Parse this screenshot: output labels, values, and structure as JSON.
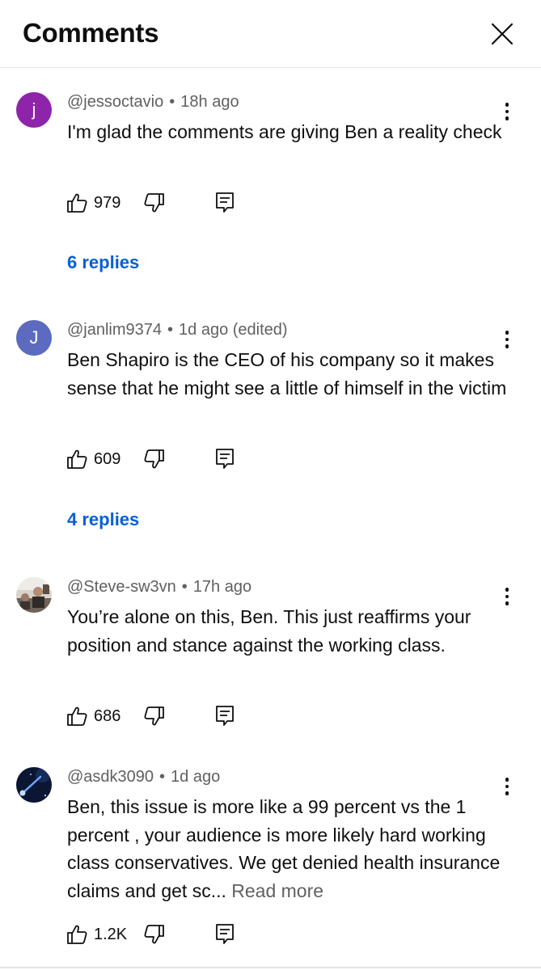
{
  "header": {
    "title": "Comments"
  },
  "comments": [
    {
      "avatar_letter": "j",
      "avatar_color": "#8e24aa",
      "handle": "@jessoctavio",
      "separator": "•",
      "time": "18h ago",
      "text": "I'm glad the comments are giving Ben a reality check",
      "likes": "979",
      "replies_label": "6 replies"
    },
    {
      "avatar_letter": "J",
      "avatar_color": "#5c6bc0",
      "handle": "@janlim9374",
      "separator": "•",
      "time": "1d ago (edited)",
      "text": "Ben Shapiro is the CEO of his company so it makes sense that he might see a little of himself in the victim",
      "likes": "609",
      "replies_label": "4 replies"
    },
    {
      "avatar_letter": "",
      "avatar_color": "#8a7f76",
      "handle": "@Steve-sw3vn",
      "separator": "•",
      "time": "17h ago",
      "text": "You’re alone on this, Ben. This just reaffirms your position and stance against the working class.",
      "likes": "686"
    },
    {
      "avatar_letter": "",
      "avatar_color": "#0d1a3a",
      "handle": "@asdk3090",
      "separator": "•",
      "time": "1d ago",
      "text": "Ben, this issue is more like a 99 percent vs the 1 percent , your audience is more likely hard working class conservatives. We get denied health insurance  claims and get sc...",
      "read_more": "Read more",
      "likes": "1.2K"
    }
  ]
}
